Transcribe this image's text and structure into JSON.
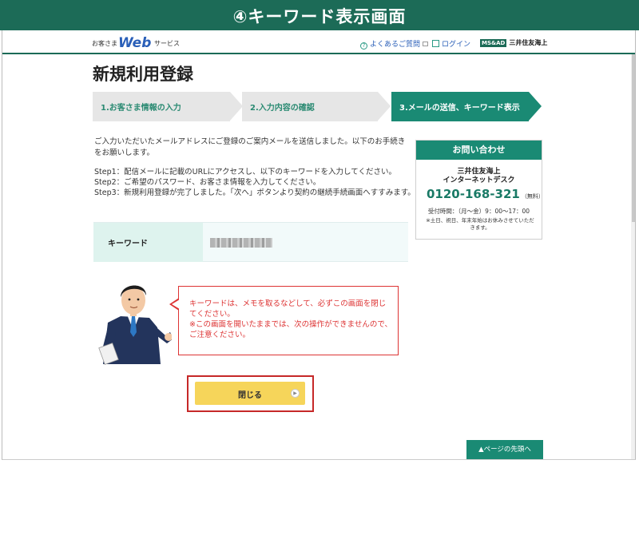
{
  "banner": {
    "title": "④キーワード表示画面"
  },
  "header": {
    "logo": {
      "prefix": "お客さま",
      "web": "Web",
      "suffix": "サービス"
    },
    "faq_label": "よくあるご質問",
    "login_label": "ログイン",
    "brand": {
      "mark": "MS&AD",
      "name": "三井住友海上"
    }
  },
  "page": {
    "title": "新規利用登録"
  },
  "steps": [
    {
      "label": "1.お客さま情報の入力",
      "state": "done"
    },
    {
      "label": "2.入力内容の確認",
      "state": "done"
    },
    {
      "label": "3.メールの送信、キーワード表示",
      "state": "current"
    }
  ],
  "intro": "ご入力いただいたメールアドレスにご登録のご案内メールを送信しました。以下のお手続きをお願いします。",
  "instructions": [
    "Step1：配信メールに記載のURLにアクセスし、以下のキーワードを入力してください。",
    "Step2：ご希望のパスワード、お客さま情報を入力してください。",
    "Step3：新規利用登録が完了しました。「次へ」ボタンより契約の継続手続画面へすすみます。"
  ],
  "keyword": {
    "label": "キーワード"
  },
  "contact": {
    "heading": "お問い合わせ",
    "name_line1": "三井住友海上",
    "name_line2": "インターネットデスク",
    "phone": "0120-168-321",
    "free": "（無料）",
    "hours": "受付時間：（月〜金）9：00〜17：00",
    "note": "※土日、祝日、年末年始はお休みさせていただきます。"
  },
  "notice": {
    "line1": "キーワードは、メモを取るなどして、必ずこの画面を閉じてください。",
    "line2": "※この画面を開いたままでは、次の操作ができませんので、ご注意ください。"
  },
  "close_button": {
    "label": "閉じる"
  },
  "page_top": {
    "label": "▲ページの先頭へ"
  },
  "colors": {
    "banner": "#1c6b57",
    "accent": "#1a8a74",
    "step_inactive": "#e6e6e6",
    "warning": "#d33333",
    "button": "#f6d55a"
  }
}
